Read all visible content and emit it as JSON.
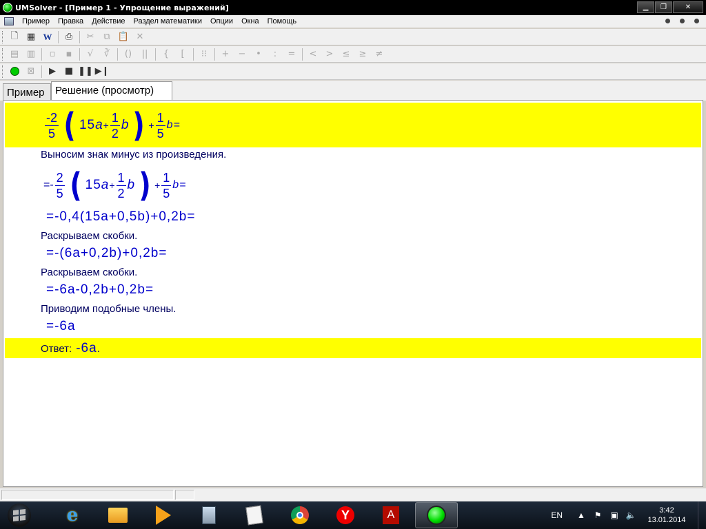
{
  "window": {
    "title": "UMSolver - [Пример 1 - Упрощение выражений]",
    "controls": [
      "minimize",
      "restore",
      "close"
    ]
  },
  "menu": [
    "Пример",
    "Правка",
    "Действие",
    "Раздел математики",
    "Опции",
    "Окна",
    "Помощь"
  ],
  "tabs": [
    {
      "label": "Пример",
      "active": false
    },
    {
      "label": "Решение (просмотр)",
      "active": true
    }
  ],
  "solution": {
    "expression": {
      "frac1_num": "-2",
      "frac1_den": "5",
      "inner_a": "15",
      "a": "a",
      "plus": "+",
      "frac2_num": "1",
      "frac2_den": "2",
      "b": "b",
      "frac3_num": "1",
      "frac3_den": "5",
      "tail": "b="
    },
    "step1_text": "Выносим знак минус из произведения.",
    "step1_prefix": "=-",
    "step1_frac1_num": "2",
    "step1_frac1_den": "5",
    "step1_inner": "15",
    "step1_frac2_num": "1",
    "step1_frac2_den": "2",
    "step1_frac3_num": "1",
    "step1_frac3_den": "5",
    "step2": "=-0,4(15a+0,5b)+0,2b=",
    "step3_text": "Раскрываем скобки.",
    "step3": "=-(6a+0,2b)+0,2b=",
    "step4_text": "Раскрываем скобки.",
    "step4": "=-6a-0,2b+0,2b=",
    "step5_text": "Приводим подобные члены.",
    "step5": "=-6a",
    "answer_label": "Ответ:",
    "answer_value": "-6a",
    "answer_period": "."
  },
  "taskbar": {
    "lang": "EN",
    "time": "3:42",
    "date": "13.01.2014"
  },
  "colors": {
    "highlight": "#ffff00",
    "math": "#0000cc",
    "text": "#000060"
  }
}
